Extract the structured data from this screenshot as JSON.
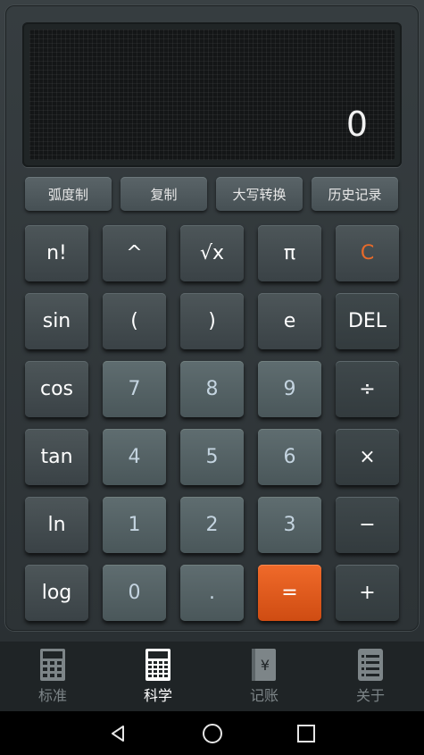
{
  "display": {
    "value": "0"
  },
  "function_buttons": [
    "弧度制",
    "复制",
    "大写转换",
    "历史记录"
  ],
  "keys": [
    [
      "n!",
      "^",
      "√x",
      "π",
      "C"
    ],
    [
      "sin",
      "(",
      ")",
      "e",
      "DEL"
    ],
    [
      "cos",
      "7",
      "8",
      "9",
      "÷"
    ],
    [
      "tan",
      "4",
      "5",
      "6",
      "×"
    ],
    [
      "ln",
      "1",
      "2",
      "3",
      "−"
    ],
    [
      "log",
      "0",
      ".",
      "=",
      "+"
    ]
  ],
  "tabs": [
    {
      "label": "标准",
      "icon": "calculator-icon",
      "active": false
    },
    {
      "label": "科学",
      "icon": "scientific-calculator-icon",
      "active": true
    },
    {
      "label": "记账",
      "icon": "ledger-icon",
      "active": false
    },
    {
      "label": "关于",
      "icon": "list-icon",
      "active": false
    }
  ],
  "colors": {
    "accent": "#e8561a",
    "clear_key_text": "#e86a2a",
    "background": "#2b3133",
    "number_key_text": "#c4d4e0"
  },
  "navigation": {
    "icons": [
      "back-icon",
      "home-icon",
      "recents-icon"
    ]
  }
}
